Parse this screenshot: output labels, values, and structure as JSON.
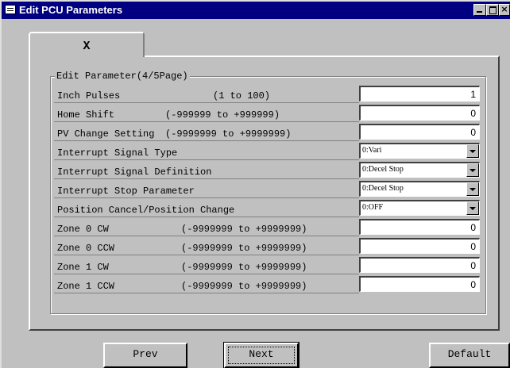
{
  "window": {
    "title": "Edit PCU Parameters",
    "controls": {
      "minimize_icon": "minimize-icon",
      "maximize_icon": "maximize-icon",
      "close_label": "×"
    }
  },
  "tab": {
    "label": "X"
  },
  "group": {
    "title": "Edit Parameter(4/5Page)"
  },
  "rows": [
    {
      "label": "Inch Pulses",
      "range": "(1 to 100)",
      "kind": "input",
      "value": "1"
    },
    {
      "label": "Home Shift",
      "range": "(-999999 to +999999)",
      "kind": "input",
      "value": "0"
    },
    {
      "label": "PV Change Setting",
      "range": "(-9999999 to +9999999)",
      "kind": "input",
      "value": "0"
    },
    {
      "label": "Interrupt Signal Type",
      "range": "",
      "kind": "select",
      "value": "0:Vari"
    },
    {
      "label": "Interrupt Signal Definition",
      "range": "",
      "kind": "select",
      "value": "0:Decel Stop"
    },
    {
      "label": "Interrupt Stop Parameter",
      "range": "",
      "kind": "select",
      "value": "0:Decel Stop"
    },
    {
      "label": "Position Cancel/Position Change",
      "range": "",
      "kind": "select",
      "value": "0:OFF"
    },
    {
      "label": "Zone 0 CW",
      "range": "(-9999999 to +9999999)",
      "kind": "input",
      "value": "0"
    },
    {
      "label": "Zone 0 CCW",
      "range": "(-9999999 to +9999999)",
      "kind": "input",
      "value": "0"
    },
    {
      "label": "Zone 1 CW",
      "range": "(-9999999 to +9999999)",
      "kind": "input",
      "value": "0"
    },
    {
      "label": "Zone 1 CCW",
      "range": "(-9999999 to +9999999)",
      "kind": "input",
      "value": "0"
    }
  ],
  "buttons": {
    "prev": "Prev",
    "next": "Next",
    "default": "Default"
  }
}
